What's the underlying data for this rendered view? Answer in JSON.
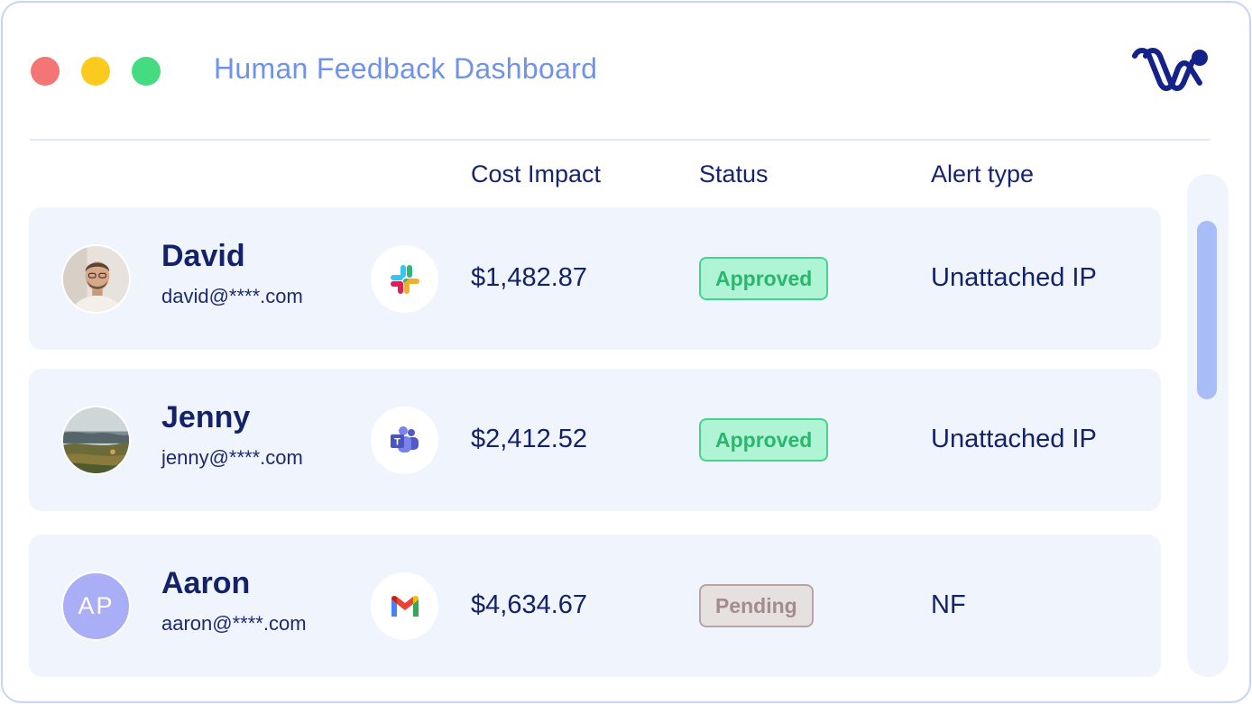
{
  "window": {
    "title": "Human Feedback Dashboard",
    "controls": [
      "close",
      "minimize",
      "maximize"
    ],
    "logo": "w-brand-logo"
  },
  "table": {
    "headers": {
      "cost": "Cost Impact",
      "status": "Status",
      "alert": "Alert type"
    },
    "rows": [
      {
        "name": "David",
        "email": "david@****.com",
        "avatar": "photo-portrait",
        "channel_icon": "slack-icon",
        "cost": "$1,482.87",
        "status": "Approved",
        "alert": "Unattached IP"
      },
      {
        "name": "Jenny",
        "email": "jenny@****.com",
        "avatar": "photo-landscape",
        "channel_icon": "microsoft-teams-icon",
        "cost": "$2,412.52",
        "status": "Approved",
        "alert": "Unattached IP"
      },
      {
        "name": "Aaron",
        "email": "aaron@****.com",
        "avatar": "initials",
        "initials": "AP",
        "channel_icon": "gmail-icon",
        "cost": "$4,634.67",
        "status": "Pending",
        "alert": "NF"
      }
    ]
  },
  "colors": {
    "accent": "#6f93e8",
    "text": "#14226a",
    "approved": "#2bb66e",
    "pending": "#a48c8c",
    "row_bg": "#f0f4fd"
  }
}
